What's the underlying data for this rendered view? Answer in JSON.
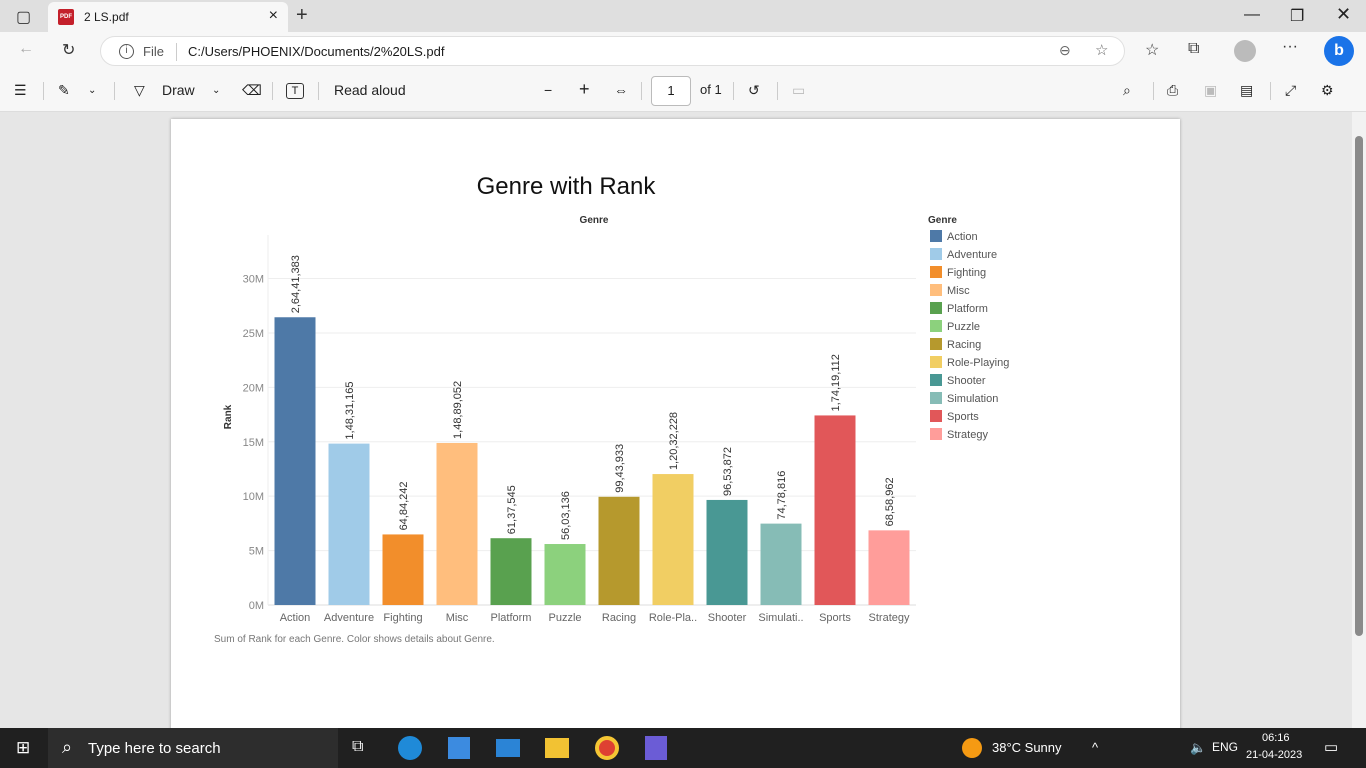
{
  "browser": {
    "tab_title": "2 LS.pdf",
    "address_scheme": "File",
    "address_url": "C:/Users/PHOENIX/Documents/2%20LS.pdf"
  },
  "pdf_toolbar": {
    "draw_label": "Draw",
    "read_aloud_label": "Read aloud",
    "page_current": "1",
    "page_total": "of 1"
  },
  "chart_data": {
    "type": "bar",
    "title": "Genre with Rank",
    "column_header": "Genre",
    "ylabel": "Rank",
    "ylim": [
      0,
      34000000
    ],
    "yticks": [
      0,
      5000000,
      10000000,
      15000000,
      20000000,
      25000000,
      30000000
    ],
    "ytick_labels": [
      "0M",
      "5M",
      "10M",
      "15M",
      "20M",
      "25M",
      "30M"
    ],
    "categories": [
      "Action",
      "Adventure",
      "Fighting",
      "Misc",
      "Platform",
      "Puzzle",
      "Racing",
      "Role-Playing",
      "Shooter",
      "Simulation",
      "Sports",
      "Strategy"
    ],
    "tick_labels": [
      "Action",
      "Adventure",
      "Fighting",
      "Misc",
      "Platform",
      "Puzzle",
      "Racing",
      "Role-Pla..",
      "Shooter",
      "Simulati..",
      "Sports",
      "Strategy"
    ],
    "values": [
      26441383,
      14831165,
      6484242,
      14889052,
      6137545,
      5603136,
      9943933,
      12032228,
      9653872,
      7478816,
      17419112,
      6858962
    ],
    "value_labels": [
      "2,64,41,383",
      "1,48,31,165",
      "64,84,242",
      "1,48,89,052",
      "61,37,545",
      "56,03,136",
      "99,43,933",
      "1,20,32,228",
      "96,53,872",
      "74,78,816",
      "1,74,19,112",
      "68,58,962"
    ],
    "colors": [
      "#4e79a7",
      "#a0cbe8",
      "#f28e2b",
      "#ffbe7d",
      "#59a14f",
      "#8cd17d",
      "#b6992d",
      "#f1ce63",
      "#499894",
      "#86bcb6",
      "#e15759",
      "#ff9d9a"
    ],
    "legend_title": "Genre",
    "legend_position": "right",
    "grid": true,
    "caption": "Sum of Rank for each Genre.  Color shows details about Genre."
  },
  "taskbar": {
    "search_placeholder": "Type here to search",
    "weather": "38°C  Sunny",
    "lang": "ENG",
    "time": "06:16",
    "date": "21-04-2023"
  }
}
